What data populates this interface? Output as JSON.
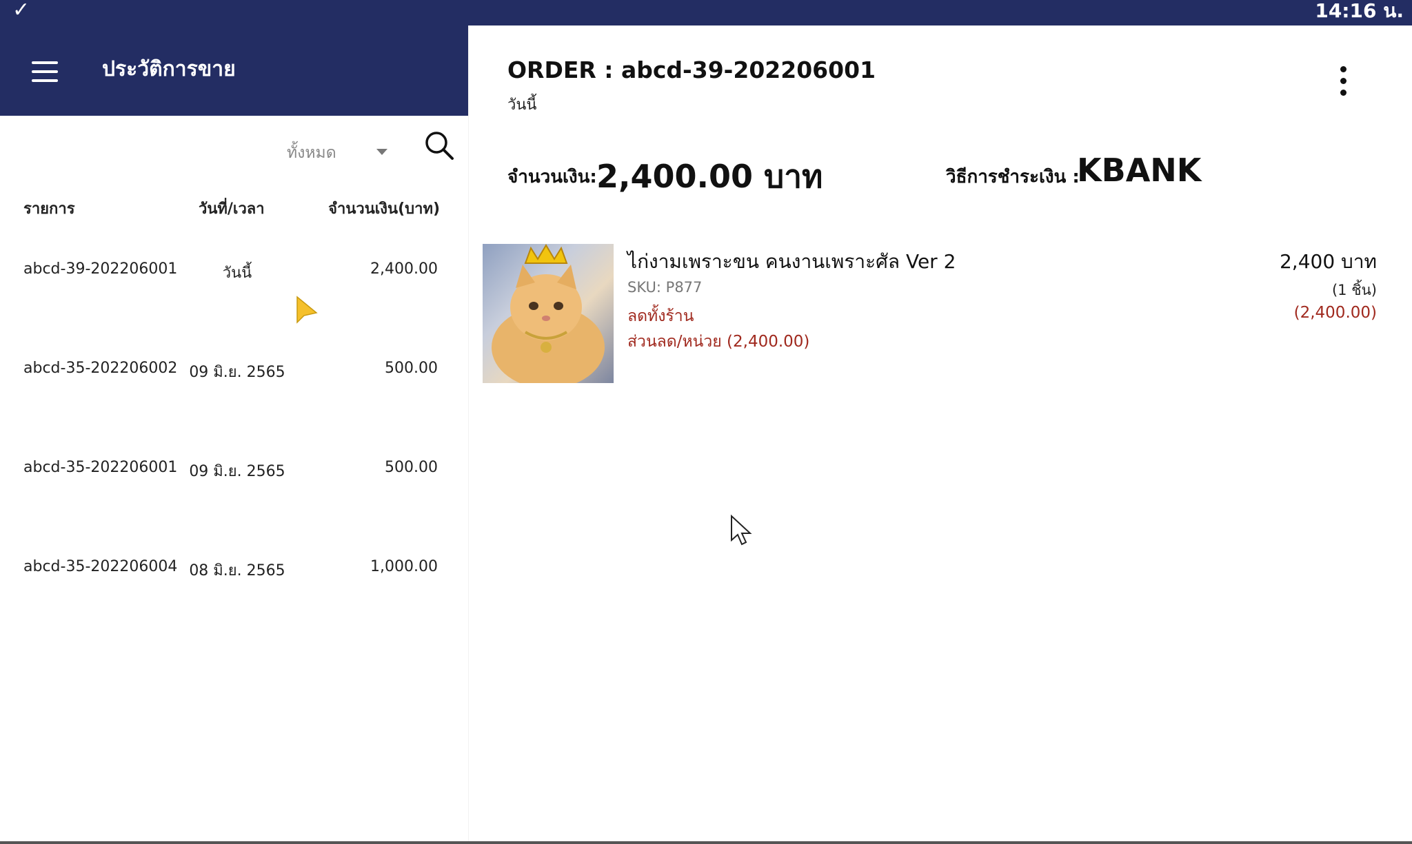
{
  "status_bar": {
    "time": "14:16 น."
  },
  "appbar": {
    "title": "ประวัติการขาย"
  },
  "filter": {
    "selected": "ทั้งหมด"
  },
  "list": {
    "headers": {
      "item": "รายการ",
      "date": "วันที่/เวลา",
      "amount": "จำนวนเงิน(บาท)"
    },
    "rows": [
      {
        "item": "abcd-39-202206001",
        "date": "วันนี้",
        "amount": "2,400.00"
      },
      {
        "item": "abcd-35-202206002",
        "date": "09 มิ.ย. 2565",
        "amount": "500.00"
      },
      {
        "item": "abcd-35-202206001",
        "date": "09 มิ.ย. 2565",
        "amount": "500.00"
      },
      {
        "item": "abcd-35-202206004",
        "date": "08 มิ.ย. 2565",
        "amount": "1,000.00"
      }
    ]
  },
  "order": {
    "title": "ORDER : abcd-39-202206001",
    "subtitle": "วันนี้",
    "amount_label": "จำนวนเงิน:",
    "amount_value": "2,400.00 บาท",
    "payment_label": "วิธีการชำระเงิน :",
    "payment_value": "KBANK",
    "product": {
      "name": "ไก่งามเพราะขน คนงานเพราะศัล Ver 2",
      "sku": "SKU: P877",
      "discount_label": "ลดทั้งร้าน",
      "discount_unit": "ส่วนลด/หน่วย (2,400.00)",
      "price": "2,400 บาท",
      "qty": "(1 ชิ้น)",
      "discount_amount": "(2,400.00)"
    }
  },
  "colors": {
    "header_bg": "#232d63",
    "discount": "#a0291e"
  },
  "icons": [
    "check-icon",
    "menu-icon",
    "dropdown-caret-icon",
    "search-icon",
    "more-vert-icon",
    "cursor-icon"
  ]
}
